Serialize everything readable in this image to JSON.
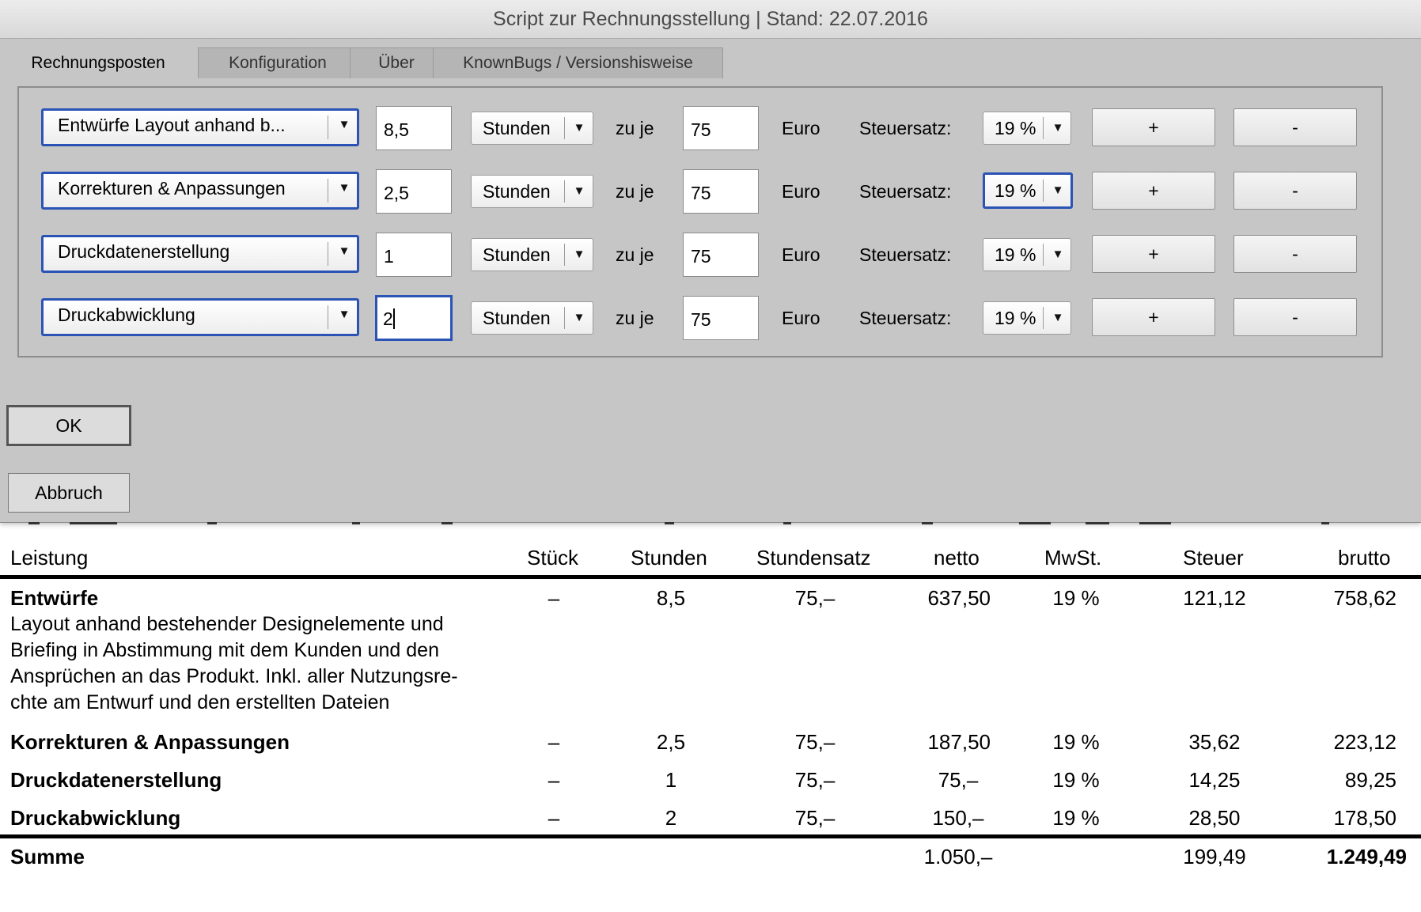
{
  "window": {
    "title": "Script zur Rechnungsstellung | Stand: 22.07.2016"
  },
  "tabs": [
    {
      "label": "Rechnungsposten"
    },
    {
      "label": "Konfiguration"
    },
    {
      "label": "Über"
    },
    {
      "label": "KnownBugs / Versionshisweise"
    }
  ],
  "rows": [
    {
      "item": "Entwürfe  Layout anhand b...",
      "quantity": "8,5",
      "unit": "Stunden",
      "zu_je": "zu je",
      "rate": "75",
      "currency": "Euro",
      "tax_label": "Steuersatz:",
      "tax": "19 %",
      "plus": "+",
      "minus": "-"
    },
    {
      "item": "Korrekturen & Anpassungen",
      "quantity": "2,5",
      "unit": "Stunden",
      "zu_je": "zu je",
      "rate": "75",
      "currency": "Euro",
      "tax_label": "Steuersatz:",
      "tax": "19 %",
      "plus": "+",
      "minus": "-"
    },
    {
      "item": "Druckdatenerstellung",
      "quantity": "1",
      "unit": "Stunden",
      "zu_je": "zu je",
      "rate": "75",
      "currency": "Euro",
      "tax_label": "Steuersatz:",
      "tax": "19 %",
      "plus": "+",
      "minus": "-"
    },
    {
      "item": "Druckabwicklung",
      "quantity": "2",
      "unit": "Stunden",
      "zu_je": "zu je",
      "rate": "75",
      "currency": "Euro",
      "tax_label": "Steuersatz:",
      "tax": "19 %",
      "plus": "+",
      "minus": "-"
    }
  ],
  "buttons": {
    "ok": "OK",
    "cancel": "Abbruch"
  },
  "invoice": {
    "headers": {
      "leistung": "Leistung",
      "stueck": "Stück",
      "stunden": "Stunden",
      "stundensatz": "Stundensatz",
      "netto": "netto",
      "mwst": "MwSt.",
      "steuer": "Steuer",
      "brutto": "brutto"
    },
    "rows": [
      {
        "leistung": "Entwürfe",
        "stueck": "–",
        "stunden": "8,5",
        "stundensatz": "75,–",
        "netto": "637,50",
        "mwst": "19 %",
        "steuer": "121,12",
        "brutto": "758,62"
      },
      {
        "leistung": "Korrekturen & Anpassungen",
        "stueck": "–",
        "stunden": "2,5",
        "stundensatz": "75,–",
        "netto": "187,50",
        "mwst": "19 %",
        "steuer": "35,62",
        "brutto": "223,12"
      },
      {
        "leistung": "Druckdatenerstellung",
        "stueck": "–",
        "stunden": "1",
        "stundensatz": "75,–",
        "netto": "75,–",
        "mwst": "19 %",
        "steuer": "14,25",
        "brutto": "89,25"
      },
      {
        "leistung": "Druckabwicklung",
        "stueck": "–",
        "stunden": "2",
        "stundensatz": "75,–",
        "netto": "150,–",
        "mwst": "19 %",
        "steuer": "28,50",
        "brutto": "178,50"
      }
    ],
    "description_lines": [
      "Layout anhand bestehender Designelemente und",
      "Briefing in Abstimmung mit dem Kunden und den",
      "Ansprüchen an das Produkt. Inkl. aller Nutzungsre-",
      "chte am Entwurf und den erstellten Dateien"
    ],
    "sum": {
      "label": "Summe",
      "netto": "1.050,–",
      "steuer": "199,49",
      "brutto": "1.249,49"
    }
  }
}
